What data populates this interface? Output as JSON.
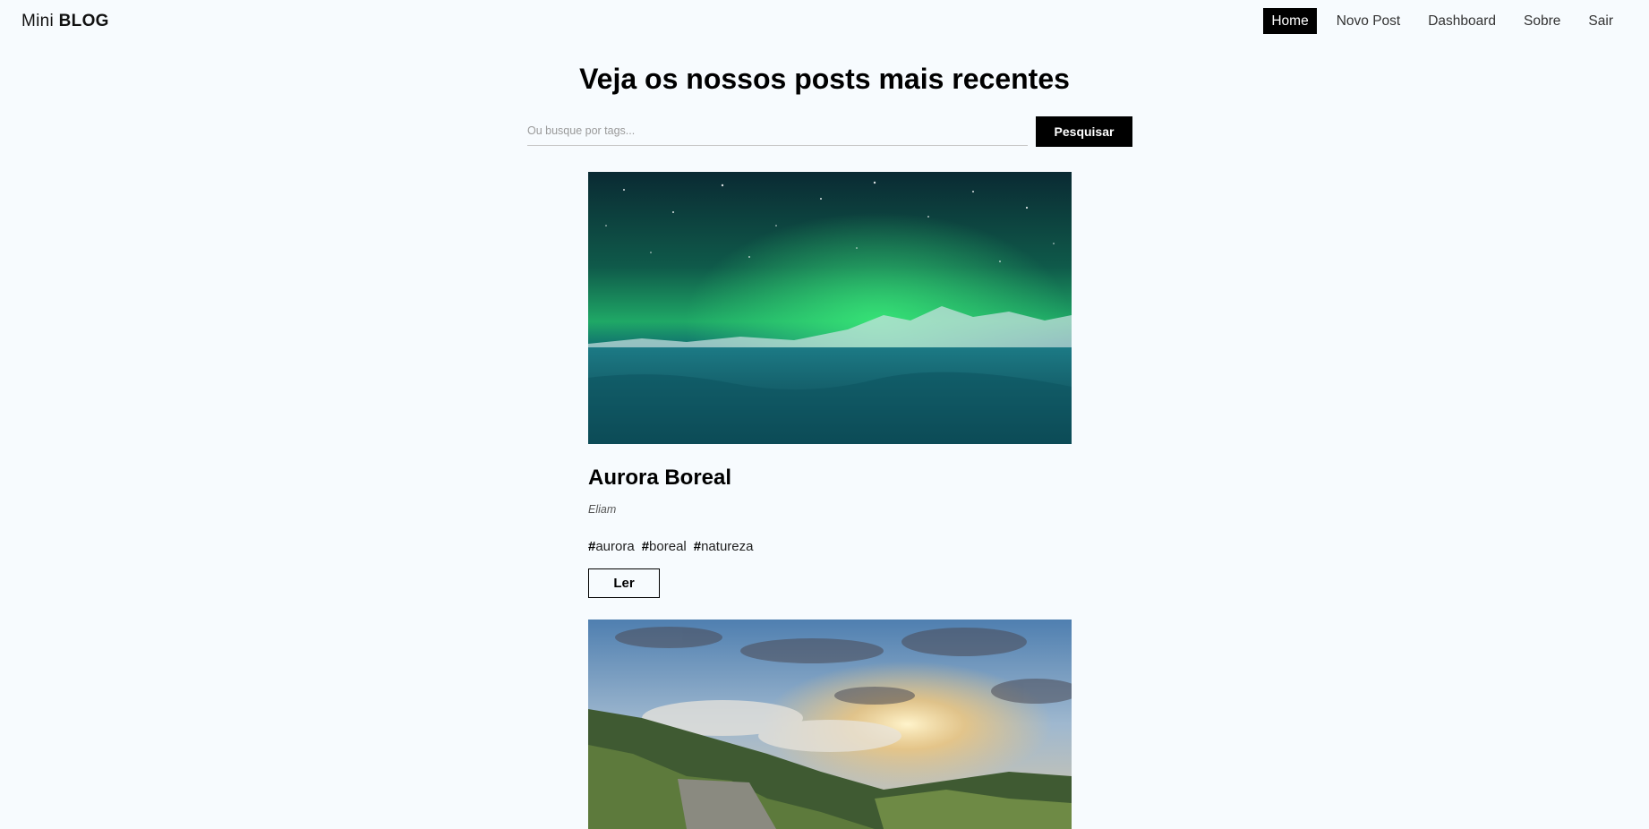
{
  "brand": {
    "light": "Mini",
    "bold": "BLOG"
  },
  "nav": {
    "items": [
      {
        "label": "Home",
        "active": true
      },
      {
        "label": "Novo Post"
      },
      {
        "label": "Dashboard"
      },
      {
        "label": "Sobre"
      },
      {
        "label": "Sair"
      }
    ]
  },
  "page_title": "Veja os nossos posts mais recentes",
  "search": {
    "placeholder": "Ou busque por tags...",
    "value": "",
    "button_label": "Pesquisar"
  },
  "posts": [
    {
      "title": "Aurora Boreal",
      "author": "Eliam",
      "tags": [
        "aurora",
        "boreal",
        "natureza"
      ],
      "read_label": "Ler",
      "image_alt": "Aurora boreal sobre paisagem gelada"
    },
    {
      "image_alt": "Montanhas verdes com nuvens ao pôr do sol"
    }
  ],
  "colors": {
    "background": "#f7fbfe",
    "accent": "#000000",
    "text": "#111111"
  }
}
